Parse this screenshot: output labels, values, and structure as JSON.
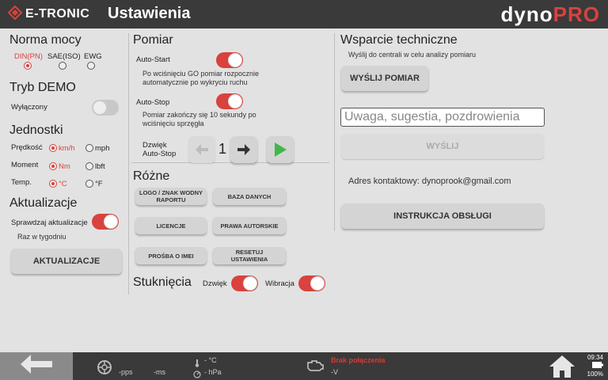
{
  "header": {
    "logo_text": "E-TRONIC",
    "title": "Ustawienia",
    "brand_a": "dyno",
    "brand_b": "PRO"
  },
  "norma": {
    "title": "Norma mocy",
    "options": [
      "DIN(PN)",
      "SAE(ISO)",
      "EWG"
    ],
    "selected": "DIN(PN)"
  },
  "demo": {
    "title": "Tryb DEMO",
    "label": "Wyłączony"
  },
  "jednostki": {
    "title": "Jednostki",
    "rows": [
      {
        "label": "Prędkość",
        "opt1": "km/h",
        "opt2": "mph"
      },
      {
        "label": "Moment",
        "opt1": "Nm",
        "opt2": "lbft"
      },
      {
        "label": "Temp.",
        "opt1": "°C",
        "opt2": "°F"
      }
    ]
  },
  "aktualizacje": {
    "title": "Aktualizacje",
    "check_label": "Sprawdzaj aktualizacje",
    "frequency": "Raz w tygodniu",
    "button": "AKTUALIZACJE"
  },
  "pomiar": {
    "title": "Pomiar",
    "auto_start": "Auto-Start",
    "auto_start_desc": "Po wciśnięciu GO pomiar rozpocznie automatycznie po wykryciu ruchu",
    "auto_stop": "Auto-Stop",
    "auto_stop_desc": "Pomiar zakończy się 10 sekundy po wciśnięciu sprzęgła",
    "sound_label_1": "Dzwięk",
    "sound_label_2": "Auto-Stop",
    "sound_value": "1"
  },
  "rozne": {
    "title": "Różne",
    "buttons": [
      "LOGO / ZNAK WODNY RAPORTU",
      "BAZA DANYCH",
      "LICENCJE",
      "PRAWA AUTORSKIE",
      "PROŚBA O IMEI",
      "RESETUJ USTAWIENIA"
    ]
  },
  "stukniecia": {
    "title": "Stuknięcia",
    "sound": "Dzwięk",
    "vibration": "Wibracja"
  },
  "support": {
    "title": "Wsparcie techniczne",
    "desc": "Wyślij do centrali w celu analizy pomiaru",
    "send_measure": "WYŚLIJ POMIAR",
    "input_placeholder": "Uwaga, sugestia, pozdrowienia",
    "send": "WYŚLIJ",
    "contact": "Adres kontaktowy: dynoprook@gmail.com",
    "manual": "INSTRUKCJA OBSŁUGI"
  },
  "footer": {
    "pps": "-pps",
    "ms": "-ms",
    "temp": "- °C",
    "pressure": "- hPa",
    "volt": "-V",
    "warning": "Brak połączenia",
    "time": "09:34",
    "battery": "100%"
  },
  "colors": {
    "accent": "#d9423e",
    "header_bg": "#3a3a3a",
    "body_bg": "#e2e2e2"
  }
}
